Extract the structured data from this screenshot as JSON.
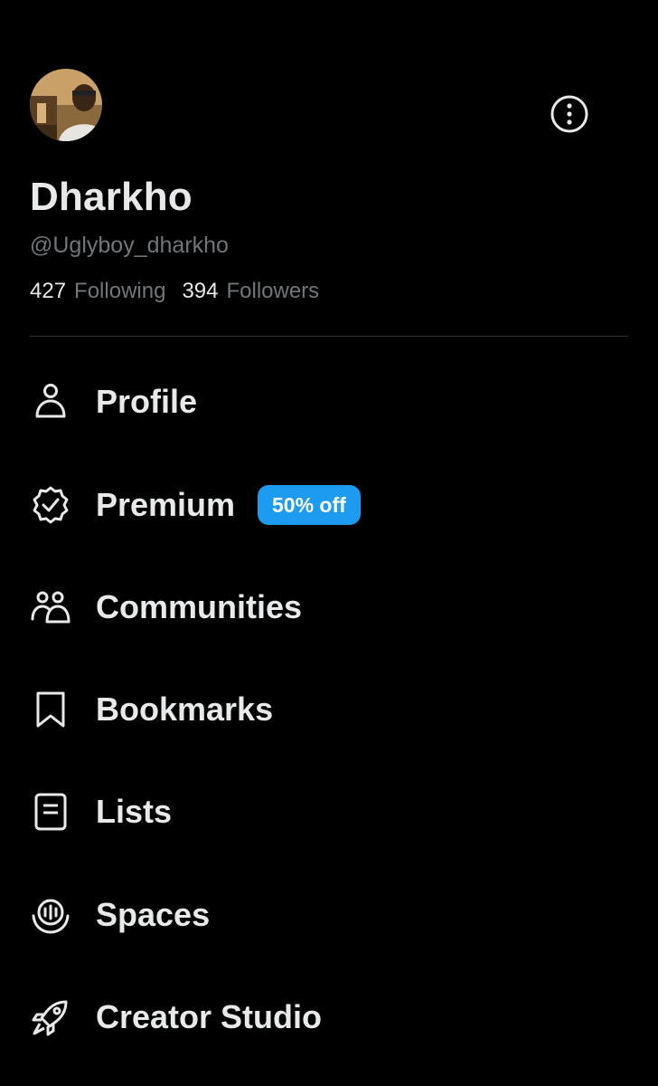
{
  "profile": {
    "display_name": "Dharkho",
    "handle": "@Uglyboy_dharkho",
    "following_count": "427",
    "following_label": "Following",
    "followers_count": "394",
    "followers_label": "Followers"
  },
  "menu": [
    {
      "label": "Profile",
      "icon": "person-icon"
    },
    {
      "label": "Premium",
      "icon": "verified-badge-icon",
      "badge": "50% off"
    },
    {
      "label": "Communities",
      "icon": "communities-icon"
    },
    {
      "label": "Bookmarks",
      "icon": "bookmark-icon"
    },
    {
      "label": "Lists",
      "icon": "list-icon"
    },
    {
      "label": "Spaces",
      "icon": "spaces-icon"
    },
    {
      "label": "Creator Studio",
      "icon": "rocket-icon"
    }
  ],
  "colors": {
    "background": "#000000",
    "text_primary": "#e7e9ea",
    "text_secondary": "#71767b",
    "divider": "#2f3336",
    "badge_accent": "#1d9bf0"
  }
}
